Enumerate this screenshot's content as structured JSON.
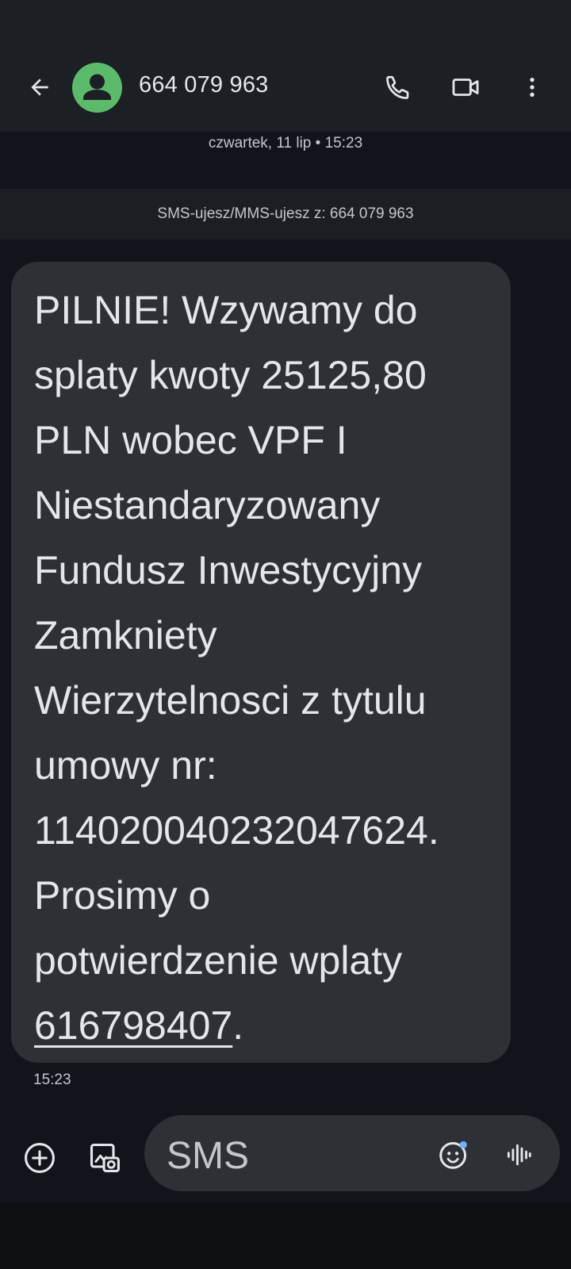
{
  "header": {
    "contact_name": "664 079 963",
    "back_icon": "arrow-back-icon",
    "avatar_icon": "person-icon",
    "call_icon": "phone-icon",
    "video_icon": "videocam-icon",
    "more_icon": "more-vert-icon"
  },
  "conversation": {
    "date_label": "czwartek, 11 lip • 15:23",
    "info_label": "SMS-ujesz/MMS-ujesz z: 664 079 963",
    "message": {
      "lines": [
        "PILNIE! Wzywamy do",
        "splaty kwoty 25125,80",
        "PLN wobec VPF I",
        "Niestandaryzowany",
        "Fundusz Inwestycyjny",
        "Zamkniety",
        "Wierzytelnosci z tytulu",
        "umowy nr:",
        "114020040232047624.",
        "Prosimy o",
        "potwierdzenie wplaty"
      ],
      "phone_link": "616798407",
      "trailing": ".",
      "time": "15:23"
    }
  },
  "compose": {
    "placeholder": "SMS",
    "add_icon": "add-circle-icon",
    "gallery_icon": "gallery-icon",
    "emoji_icon": "emoji-icon",
    "voice_icon": "voice-waveform-icon"
  },
  "colors": {
    "background": "#11141a",
    "topbar": "#1c1f24",
    "bubble": "#2d3035",
    "avatar": "#5cbb6b",
    "text": "#e6e6ea",
    "secondary_text": "#c4c6cc",
    "emoji_badge": "#6fb3ff"
  }
}
